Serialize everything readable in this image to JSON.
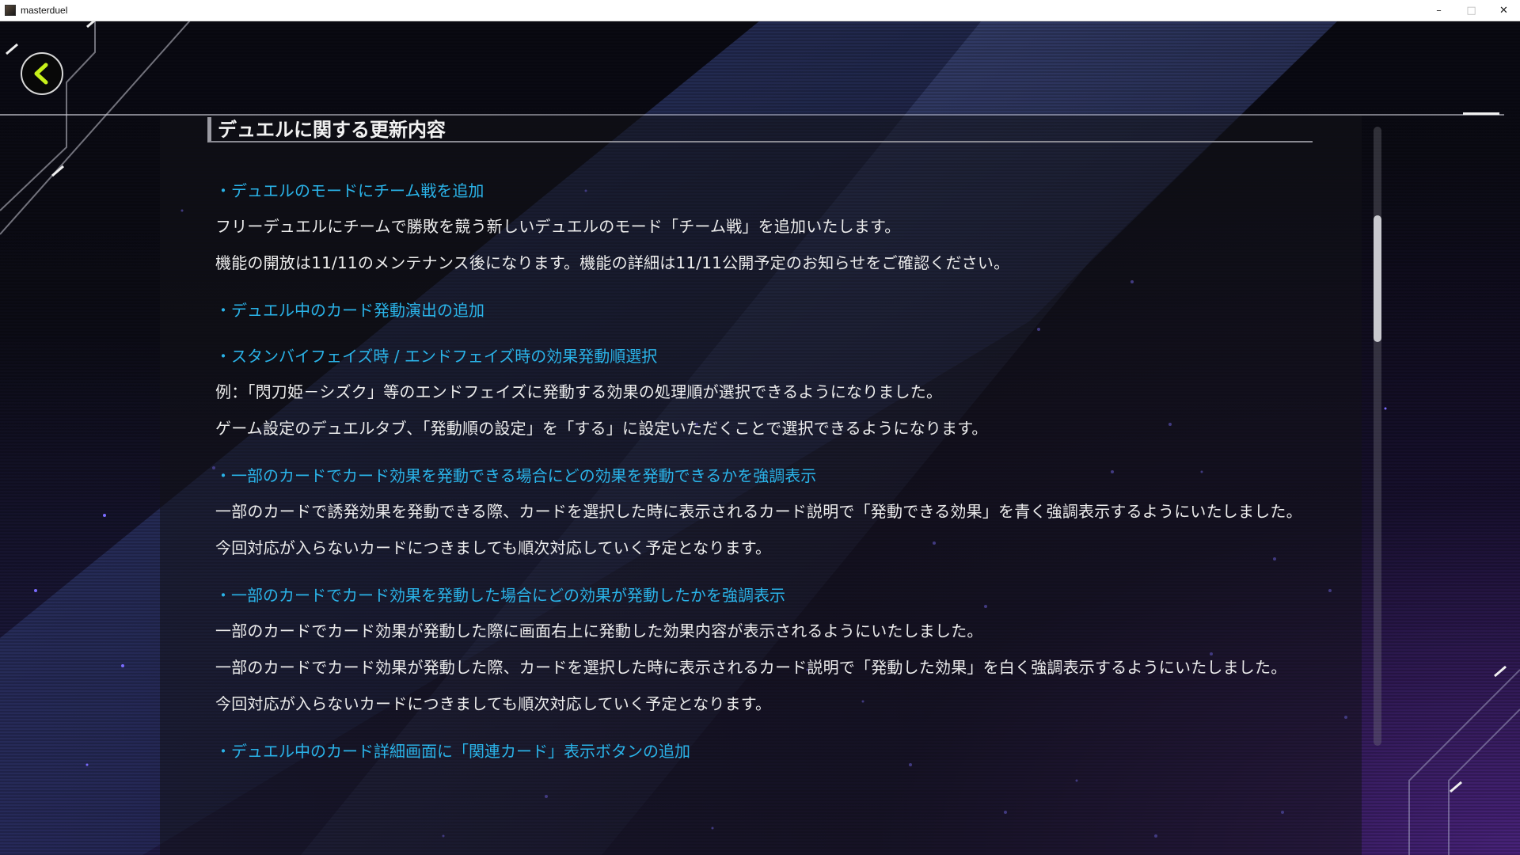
{
  "window": {
    "title": "masterduel",
    "controls": {
      "minimize": "–",
      "maximize": "□",
      "close": "✕"
    }
  },
  "colors": {
    "heading": "#2ab3e8",
    "body_text": "#ececec",
    "back_arrow": "#c6f01a",
    "background_glow": "#5a2896"
  },
  "icons": {
    "back": "chevron-left-icon",
    "app": "masterduel-app-icon"
  },
  "section": {
    "title": "デュエルに関する更新内容"
  },
  "items": [
    {
      "heading": "・デュエルのモードにチーム戦を追加",
      "paragraphs": [
        "フリーデュエルにチームで勝敗を競う新しいデュエルのモード「チーム戦」を追加いたします。",
        "機能の開放は11/11のメンテナンス後になります。機能の詳細は11/11公開予定のお知らせをご確認ください。"
      ]
    },
    {
      "heading": "・デュエル中のカード発動演出の追加",
      "paragraphs": []
    },
    {
      "heading": "・スタンバイフェイズ時 / エンドフェイズ時の効果発動順選択",
      "paragraphs": [
        "例：「閃刀姫－シズク」等のエンドフェイズに発動する効果の処理順が選択できるようになりました。",
        "ゲーム設定のデュエルタブ、「発動順の設定」を「する」に設定いただくことで選択できるようになります。"
      ]
    },
    {
      "heading": "・一部のカードでカード効果を発動できる場合にどの効果を発動できるかを強調表示",
      "paragraphs": [
        "一部のカードで誘発効果を発動できる際、カードを選択した時に表示されるカード説明で「発動できる効果」を青く強調表示するようにいたしました。",
        "今回対応が入らないカードにつきましても順次対応していく予定となります。"
      ]
    },
    {
      "heading": "・一部のカードでカード効果を発動した場合にどの効果が発動したかを強調表示",
      "paragraphs": [
        "一部のカードでカード効果が発動した際に画面右上に発動した効果内容が表示されるようにいたしました。",
        "一部のカードでカード効果が発動した際、カードを選択した時に表示されるカード説明で「発動した効果」を白く強調表示するようにいたしました。",
        "今回対応が入らないカードにつきましても順次対応していく予定となります。"
      ]
    },
    {
      "heading": "・デュエル中のカード詳細画面に「関連カード」表示ボタンの追加",
      "paragraphs": []
    }
  ],
  "scrollbar": {
    "position_fraction": 0.18
  }
}
